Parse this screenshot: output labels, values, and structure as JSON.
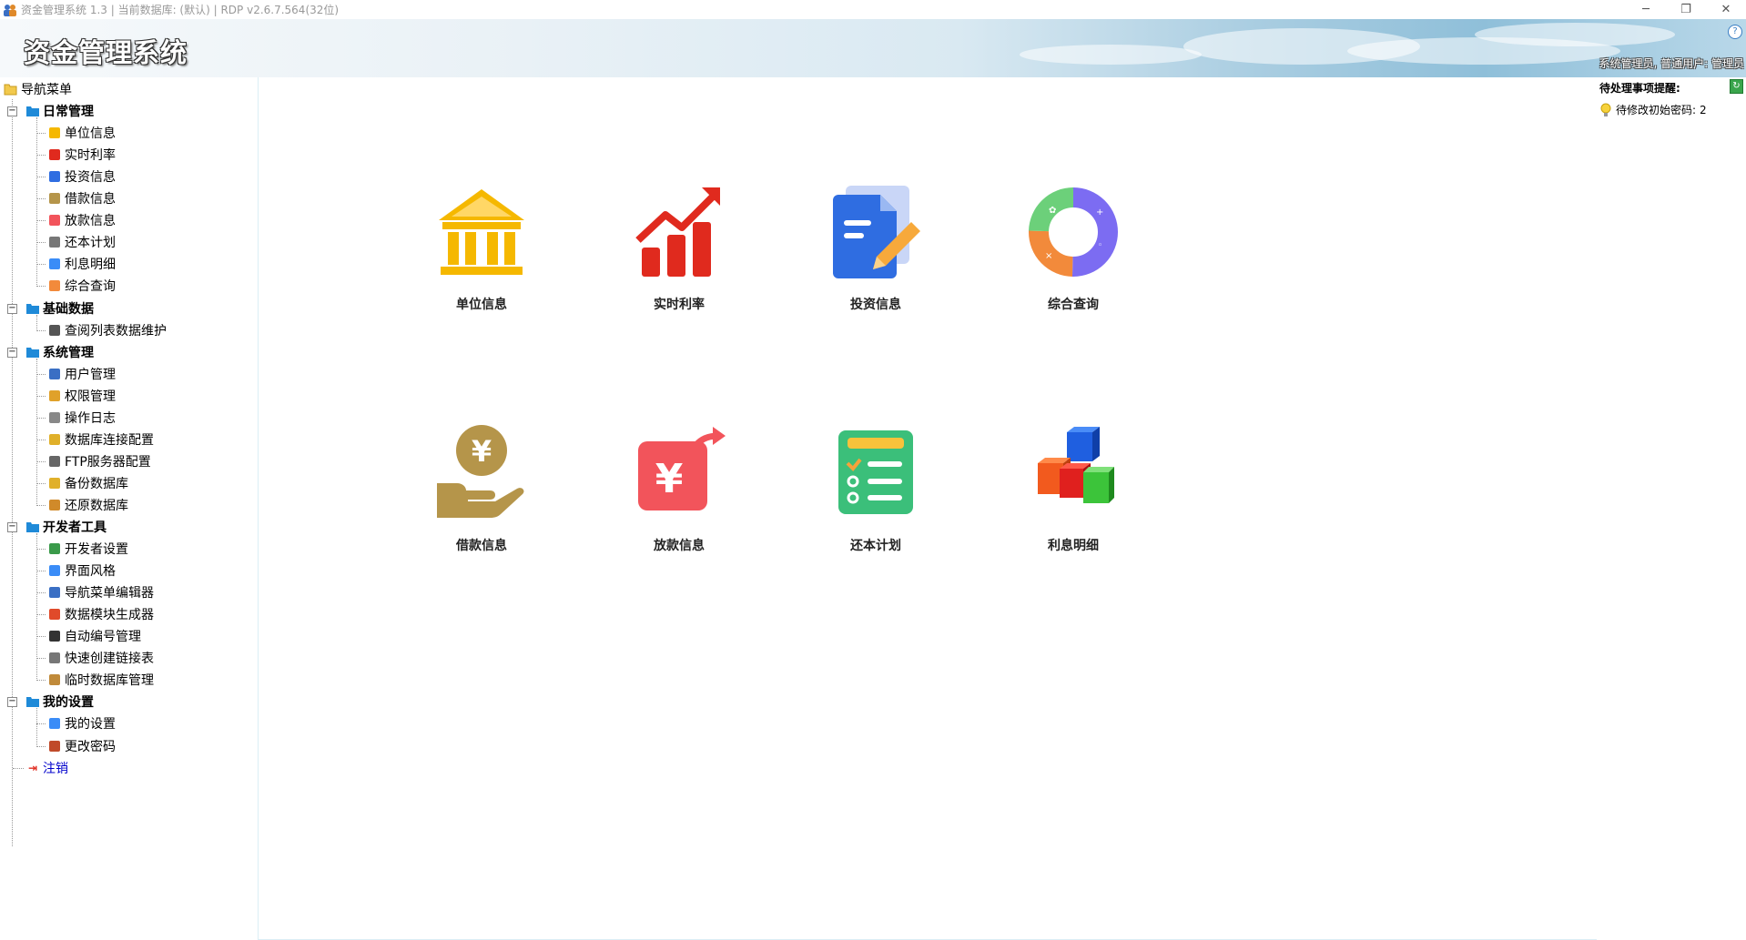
{
  "window": {
    "title": "资金管理系统 1.3 | 当前数据库: (默认) | RDP v2.6.7.564(32位)",
    "controls": [
      "minimize-icon",
      "restore-icon",
      "close-icon"
    ]
  },
  "banner": {
    "title": "资金管理系统",
    "user_info": "系统管理员, 普通用户: 管理员",
    "help": "?"
  },
  "sidebar": {
    "root": "导航菜单",
    "groups": [
      {
        "label": "日常管理",
        "items": [
          "单位信息",
          "实时利率",
          "投资信息",
          "借款信息",
          "放款信息",
          "还本计划",
          "利息明细",
          "综合查询"
        ]
      },
      {
        "label": "基础数据",
        "items": [
          "查阅列表数据维护"
        ]
      },
      {
        "label": "系统管理",
        "items": [
          "用户管理",
          "权限管理",
          "操作日志",
          "数据库连接配置",
          "FTP服务器配置",
          "备份数据库",
          "还原数据库"
        ]
      },
      {
        "label": "开发者工具",
        "items": [
          "开发者设置",
          "界面风格",
          "导航菜单编辑器",
          "数据模块生成器",
          "自动编号管理",
          "快速创建链接表",
          "临时数据库管理"
        ]
      },
      {
        "label": "我的设置",
        "items": [
          "我的设置",
          "更改密码"
        ]
      }
    ],
    "logout": "注销"
  },
  "tiles": [
    {
      "label": "单位信息",
      "icon": "bank-icon"
    },
    {
      "label": "实时利率",
      "icon": "rising-chart-icon"
    },
    {
      "label": "投资信息",
      "icon": "document-pen-icon"
    },
    {
      "label": "综合查询",
      "icon": "donut-chart-icon"
    },
    {
      "label": "借款信息",
      "icon": "yen-hand-icon"
    },
    {
      "label": "放款信息",
      "icon": "yen-out-icon"
    },
    {
      "label": "还本计划",
      "icon": "checklist-icon"
    },
    {
      "label": "利息明细",
      "icon": "cubes-icon"
    }
  ],
  "right_panel": {
    "header": "待处理事项提醒:",
    "item_label": "待修改初始密码:",
    "item_count": "2"
  },
  "colors": {
    "gold": "#f5b800",
    "red": "#e02a1e",
    "blue": "#2f6de1",
    "brown": "#b5954a",
    "coral": "#f2545b",
    "green": "#3bbf7a"
  }
}
